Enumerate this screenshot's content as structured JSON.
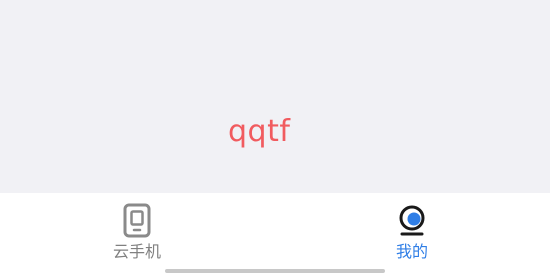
{
  "content": {
    "watermark_text": "qqtf"
  },
  "tabbar": {
    "tabs": [
      {
        "label": "云手机",
        "icon": "phone-icon",
        "active": false
      },
      {
        "label": "我的",
        "icon": "profile-icon",
        "active": true
      }
    ]
  },
  "colors": {
    "accent": "#2f7ee6",
    "inactive": "#808080",
    "watermark": "#f15b5f",
    "background": "#f1f1f5"
  }
}
